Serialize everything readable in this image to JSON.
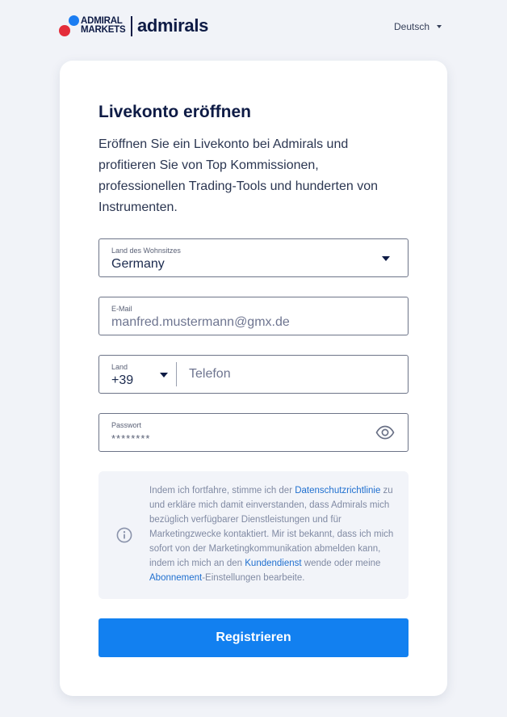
{
  "header": {
    "logo_line1": "ADMIRAL",
    "logo_line2": "MARKETS",
    "logo_word": "admirals",
    "language": "Deutsch"
  },
  "form": {
    "title": "Livekonto eröffnen",
    "intro": "Eröffnen Sie ein Livekonto bei Admirals und profitieren Sie von Top Kommissionen, professionellen Trading-Tools und hunderten von Instrumenten.",
    "country": {
      "label": "Land des Wohnsitzes",
      "value": "Germany"
    },
    "email": {
      "label": "E-Mail",
      "placeholder": "manfred.mustermann@gmx.de"
    },
    "phone": {
      "country_label": "Land",
      "country_code": "+39",
      "placeholder": "Telefon"
    },
    "password": {
      "label": "Passwort",
      "placeholder": "********"
    },
    "notice": {
      "part1": "Indem ich fortfahre, stimme ich der ",
      "link1": "Datenschutzrichtlinie",
      "part2": " zu und erkläre mich damit einverstanden, dass Admirals mich bezüglich verfügbarer Dienstleistungen und für Marketingzwecke kontaktiert. Mir ist bekannt, dass ich mich sofort von der Marketingkommunikation abmelden kann, indem ich mich an den ",
      "link2": "Kundendienst",
      "part3": " wende oder meine ",
      "link3": "Abonnement",
      "part4": "-Einstellungen bearbeite."
    },
    "submit_label": "Registrieren"
  },
  "colors": {
    "background": "#f1f3f8",
    "brand_blue": "#1b7df2",
    "brand_red": "#e42d3a",
    "button": "#1280f0",
    "link": "#1f6fcf",
    "navy": "#0e1b45"
  },
  "icons": [
    "chevron-down-icon",
    "eye-icon",
    "info-icon"
  ]
}
